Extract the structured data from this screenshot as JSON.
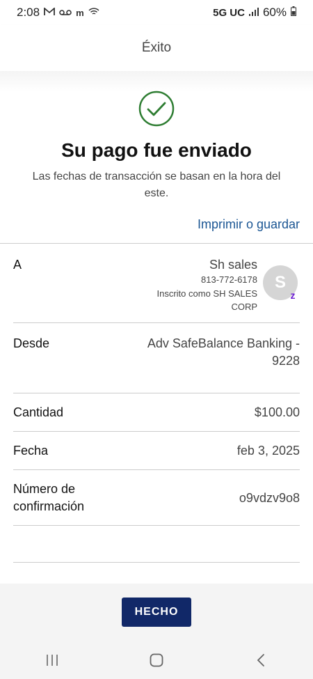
{
  "status_bar": {
    "time": "2:08",
    "network": "5G UC",
    "battery": "60%",
    "left_icons": [
      "gmail-icon",
      "voicemail-icon",
      "m-app-icon",
      "wifi-calling-icon"
    ],
    "right_icons": [
      "signal-icon",
      "battery-icon"
    ]
  },
  "header": {
    "title": "Éxito"
  },
  "confirmation": {
    "icon": "check-circle-icon",
    "icon_color": "#2e7d32",
    "title": "Su pago fue enviado",
    "subtitle": "Las fechas de transacción se basan en la hora del este.",
    "print_link": "Imprimir o guardar"
  },
  "details": {
    "to": {
      "label": "A",
      "name": "Sh sales",
      "phone": "813-772-6178",
      "enrolled_line1": "Inscrito como SH SALES",
      "enrolled_line2": "CORP",
      "avatar_letter": "S",
      "badge": "z"
    },
    "from": {
      "label": "Desde",
      "value_line1": "Adv SafeBalance Banking -",
      "value_line2": "9228"
    },
    "amount": {
      "label": "Cantidad",
      "value": "$100.00"
    },
    "date": {
      "label": "Fecha",
      "value": "feb 3, 2025"
    },
    "confirmation_number": {
      "label_line1": "Número de",
      "label_line2": "confirmación",
      "value": "o9vdzv9o8"
    }
  },
  "footer": {
    "done_label": "HECHO"
  },
  "nav": {
    "icons": [
      "recent-apps-icon",
      "home-icon",
      "back-icon"
    ]
  },
  "colors": {
    "link": "#1a5593",
    "primary_button": "#112868",
    "zelle": "#6d1ed4"
  }
}
